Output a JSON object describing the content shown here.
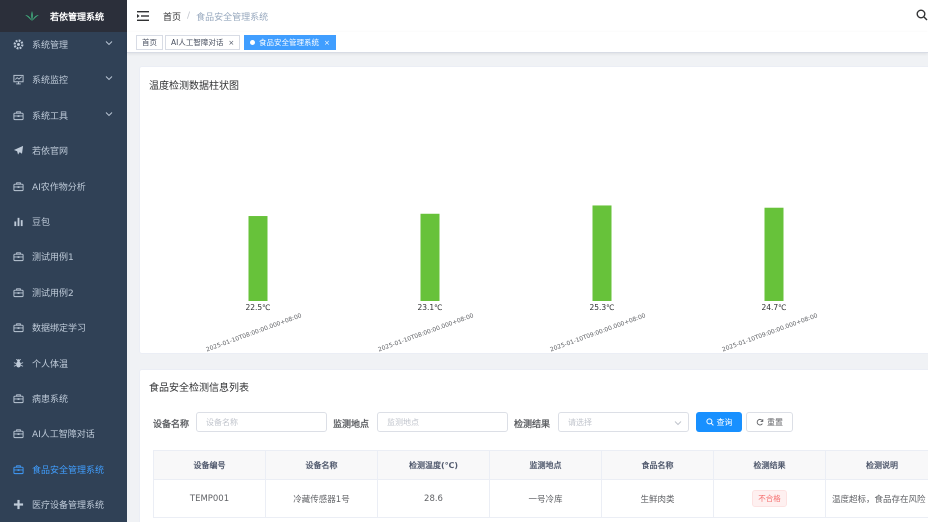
{
  "app": {
    "title": "若依管理系统"
  },
  "sidebar": {
    "items": [
      {
        "label": "系统管理",
        "icon": "gear-icon",
        "has_arrow": true
      },
      {
        "label": "系统监控",
        "icon": "monitor-icon",
        "has_arrow": true
      },
      {
        "label": "系统工具",
        "icon": "toolbox-icon",
        "has_arrow": true
      },
      {
        "label": "若依官网",
        "icon": "paper-plane-icon",
        "has_arrow": false
      },
      {
        "label": "AI农作物分析",
        "icon": "toolbox-icon",
        "has_arrow": false
      },
      {
        "label": "豆包",
        "icon": "bar-chart-icon",
        "has_arrow": false
      },
      {
        "label": "测试用例1",
        "icon": "toolbox-icon",
        "has_arrow": false
      },
      {
        "label": "测试用例2",
        "icon": "toolbox-icon",
        "has_arrow": false
      },
      {
        "label": "数据绑定学习",
        "icon": "toolbox-icon",
        "has_arrow": false
      },
      {
        "label": "个人体温",
        "icon": "bug-icon",
        "has_arrow": false
      },
      {
        "label": "病患系统",
        "icon": "toolbox-icon",
        "has_arrow": false
      },
      {
        "label": "AI人工智障对话",
        "icon": "toolbox-icon",
        "has_arrow": false
      },
      {
        "label": "食品安全管理系统",
        "icon": "toolbox-icon",
        "has_arrow": false,
        "active": true
      },
      {
        "label": "医疗设备管理系统",
        "icon": "plus-icon",
        "has_arrow": false
      }
    ]
  },
  "navbar": {
    "breadcrumb_home": "首页",
    "breadcrumb_sep": "/",
    "breadcrumb_current": "食品安全管理系统"
  },
  "tags": [
    {
      "label": "首页",
      "active": false
    },
    {
      "label": "AI人工智障对话",
      "active": false,
      "close": "×"
    },
    {
      "label": "食品安全管理系统",
      "active": true,
      "close": "×"
    }
  ],
  "chart_card": {
    "title": "温度检测数据柱状图"
  },
  "chart_data": {
    "type": "bar",
    "categories": [
      "2025-01-10T08:00:00.000+08:00",
      "2025-01-10T08:00:00.000+08:00",
      "2025-01-10T09:00:00.000+08:00",
      "2025-01-10T09:00:00.000+08:00"
    ],
    "values": [
      22.5,
      23.1,
      25.3,
      24.7
    ],
    "value_labels": [
      "22.5℃",
      "23.1℃",
      "25.3℃",
      "24.7℃"
    ],
    "ylim": [
      0,
      28.6
    ],
    "bar_color": "#67c23a",
    "grid": false
  },
  "list_card": {
    "title": "食品安全检测信息列表"
  },
  "filters": {
    "device_name_label": "设备名称",
    "device_name_placeholder": "设备名称",
    "location_label": "监测地点",
    "location_placeholder": "监测地点",
    "result_label": "检测结果",
    "result_placeholder": "请选择",
    "search_label": "查询",
    "reset_label": "重置"
  },
  "table": {
    "columns": [
      "设备编号",
      "设备名称",
      "检测温度(℃)",
      "监测地点",
      "食品名称",
      "检测结果",
      "检测说明"
    ],
    "rows": [
      {
        "device_id": "TEMP001",
        "device_name": "冷藏传感器1号",
        "temperature": "28.6",
        "location": "一号冷库",
        "food": "生鲜肉类",
        "result": "不合格",
        "description": "温度超标，食品存在风险"
      }
    ]
  },
  "colors": {
    "sidebar_bg": "#304156",
    "accent": "#409eff",
    "primary_button": "#1890ff",
    "bar": "#67c23a",
    "danger": "#f56c6c"
  }
}
